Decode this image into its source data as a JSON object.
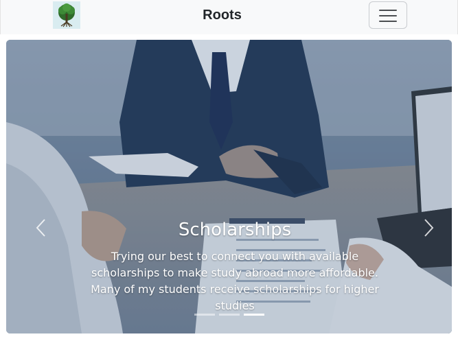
{
  "navbar": {
    "brand": "Roots",
    "logo_icon": "tree-logo-icon",
    "toggler_icon": "hamburger-menu-icon"
  },
  "carousel": {
    "active_index": 2,
    "slide_count": 3,
    "caption": {
      "title": "Scholarships",
      "text": "Trying our best to connect you with available scholarships to make study abroad more affordable. Many of my students receive scholarships for higher studies"
    },
    "prev_icon": "chevron-left-icon",
    "next_icon": "chevron-right-icon"
  }
}
